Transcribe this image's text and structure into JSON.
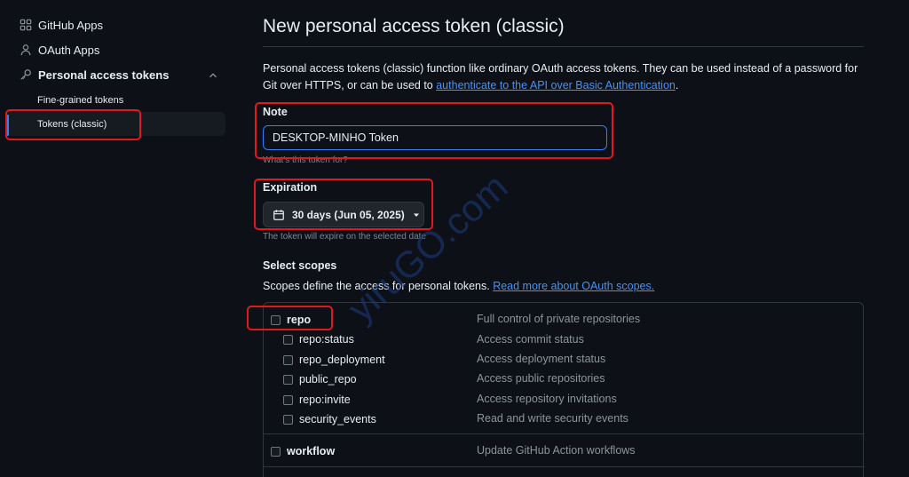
{
  "sidebar": {
    "items": [
      {
        "label": "GitHub Apps",
        "icon": "apps-grid-icon"
      },
      {
        "label": "OAuth Apps",
        "icon": "person-icon"
      },
      {
        "label": "Personal access tokens",
        "icon": "key-icon"
      }
    ],
    "sub_items": [
      {
        "label": "Fine-grained tokens"
      },
      {
        "label": "Tokens (classic)"
      }
    ]
  },
  "main": {
    "title": "New personal access token (classic)",
    "intro_text": "Personal access tokens (classic) function like ordinary OAuth access tokens. They can be used instead of a password for Git over HTTPS, or can be used to ",
    "intro_link": "authenticate to the API over Basic Authentication",
    "intro_end": ".",
    "note": {
      "label": "Note",
      "value": "DESKTOP-MINHO Token",
      "hint": "What's this token for?"
    },
    "expiration": {
      "label": "Expiration",
      "value": "30 days (Jun 05, 2025)",
      "hint": "The token will expire on the selected date"
    },
    "scopes": {
      "title": "Select scopes",
      "description": "Scopes define the access for personal tokens. ",
      "link": "Read more about OAuth scopes.",
      "items": [
        {
          "name": "repo",
          "desc": "Full control of private repositories"
        },
        {
          "name": "repo:status",
          "desc": "Access commit status"
        },
        {
          "name": "repo_deployment",
          "desc": "Access deployment status"
        },
        {
          "name": "public_repo",
          "desc": "Access public repositories"
        },
        {
          "name": "repo:invite",
          "desc": "Access repository invitations"
        },
        {
          "name": "security_events",
          "desc": "Read and write security events"
        },
        {
          "name": "workflow",
          "desc": "Update GitHub Action workflows"
        }
      ]
    }
  },
  "watermark": "yiruGO.com",
  "colors": {
    "background": "#0d1117",
    "accent": "#2f81f7",
    "link": "#4493f8",
    "highlight": "#e0191c"
  }
}
